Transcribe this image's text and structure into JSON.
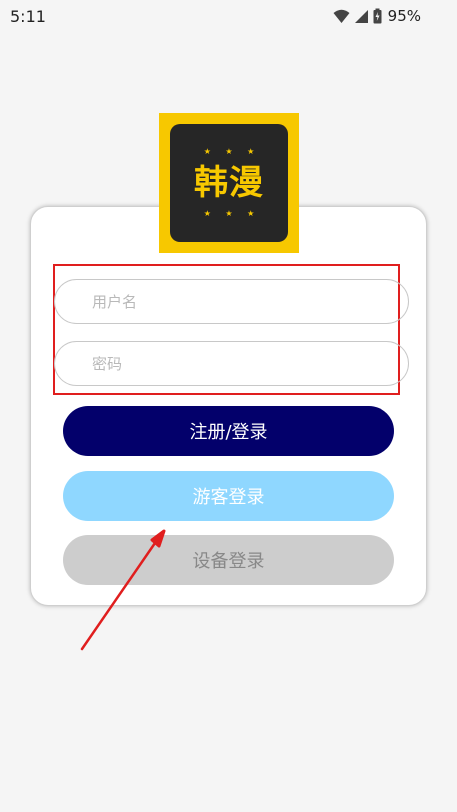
{
  "status_bar": {
    "time": "5:11",
    "battery": "95%"
  },
  "logo": {
    "stars_top": "★ ★ ★",
    "text": "韩漫",
    "stars_bottom": "★ ★ ★",
    "colors": {
      "accent": "#f7c800",
      "inner": "#262626"
    }
  },
  "login_form": {
    "username_placeholder": "用户名",
    "password_placeholder": "密码"
  },
  "buttons": {
    "register_login": "注册/登录",
    "guest_login": "游客登录",
    "device_login": "设备登录"
  },
  "colors": {
    "primary_button": "#03006b",
    "guest_button": "#8fd7ff",
    "device_button": "#cdcdcd",
    "annotation": "#e01e1e"
  }
}
